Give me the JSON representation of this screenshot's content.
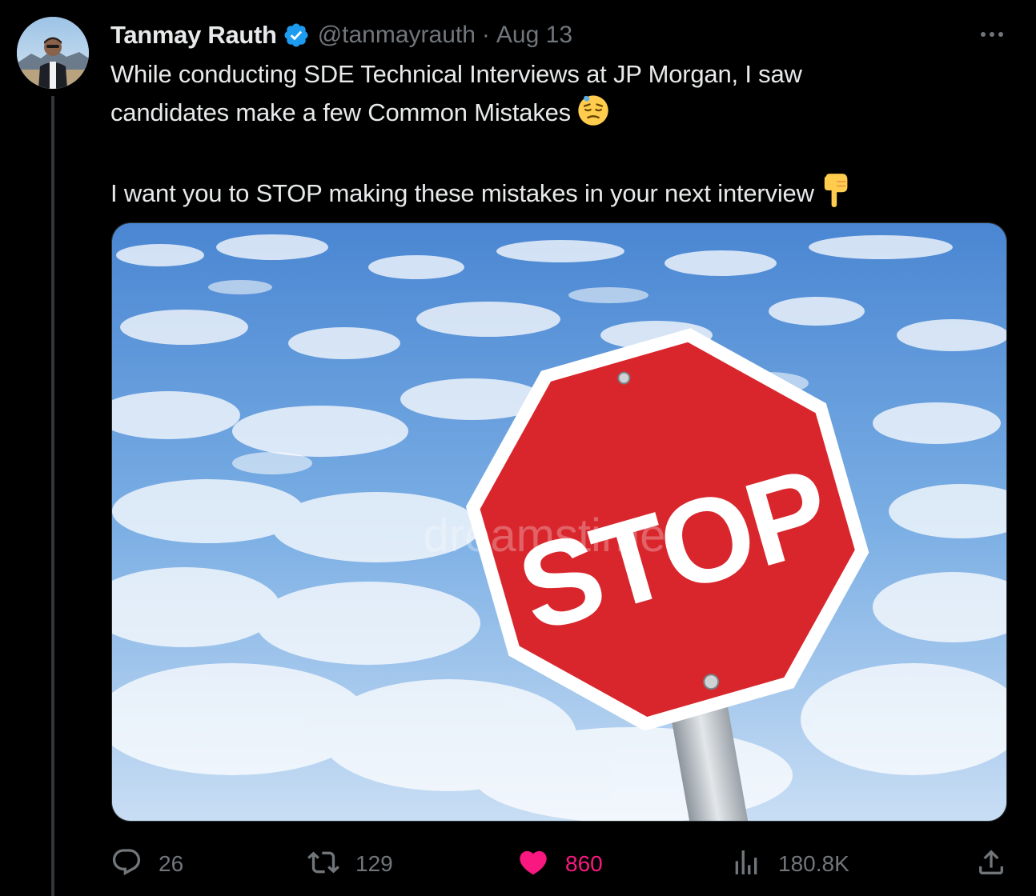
{
  "tweet": {
    "author": {
      "display_name": "Tanmay Rauth",
      "handle": "@tanmayrauth",
      "verified": true
    },
    "separator": "·",
    "date": "Aug 13",
    "text_line_1": "While conducting SDE Technical Interviews at JP Morgan, I saw",
    "text_line_2": "candidates make a few Common Mistakes",
    "text_line_2_emoji": "downcast-face-with-sweat",
    "text_line_3": "I want you to STOP making these mistakes in your next interview",
    "text_line_3_emoji": "backhand-index-pointing-down",
    "media": {
      "sign_text": "STOP",
      "watermark": "dreamstime"
    },
    "metrics": {
      "replies": "26",
      "reposts": "129",
      "likes": "860",
      "views": "180.8K"
    }
  },
  "colors": {
    "background": "#000000",
    "text": "#e7e9ea",
    "muted": "#71767b",
    "verified": "#1d9bf0",
    "like": "#f91880",
    "sign_red": "#d8262c"
  },
  "icons": [
    "more-icon",
    "verified-badge-icon",
    "reply-icon",
    "repost-icon",
    "like-icon",
    "views-icon",
    "share-icon"
  ]
}
